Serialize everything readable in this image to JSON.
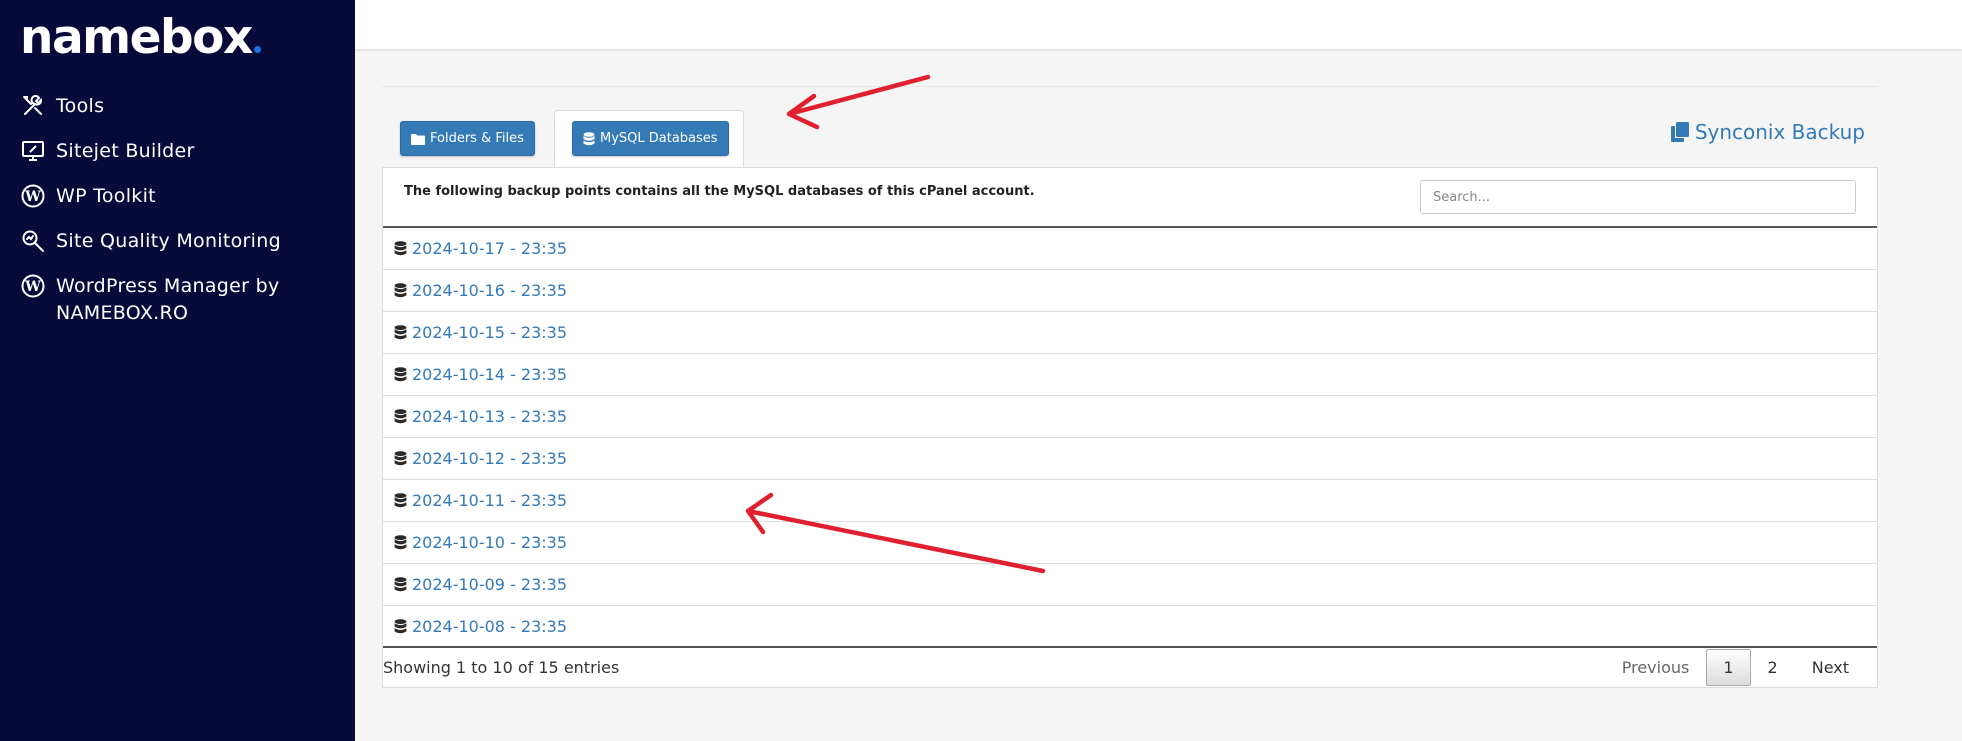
{
  "brand": {
    "logo_text": "namebox",
    "accent": "#1e6fe8"
  },
  "sidebar": {
    "items": [
      {
        "label": "Tools",
        "icon": "tools-icon"
      },
      {
        "label": "Sitejet Builder",
        "icon": "monitor-edit-icon"
      },
      {
        "label": "WP Toolkit",
        "icon": "wordpress-icon"
      },
      {
        "label": "Site Quality Monitoring",
        "icon": "magnify-icon"
      },
      {
        "label": "WordPress Manager by NAMEBOX.RO",
        "icon": "wordpress-icon"
      }
    ]
  },
  "tabs": {
    "folders_label": "Folders & Files",
    "mysql_label": "MySQL Databases"
  },
  "plugin_title": "Synconix Backup",
  "panel": {
    "description": "The following backup points contains all the MySQL databases of this cPanel account.",
    "search_placeholder": "Search..."
  },
  "backups": [
    "2024-10-17 - 23:35",
    "2024-10-16 - 23:35",
    "2024-10-15 - 23:35",
    "2024-10-14 - 23:35",
    "2024-10-13 - 23:35",
    "2024-10-12 - 23:35",
    "2024-10-11 - 23:35",
    "2024-10-10 - 23:35",
    "2024-10-09 - 23:35",
    "2024-10-08 - 23:35"
  ],
  "footer": {
    "info": "Showing 1 to 10 of 15 entries",
    "previous": "Previous",
    "pages": [
      "1",
      "2"
    ],
    "next": "Next"
  },
  "colors": {
    "sidebar_bg": "#080b3a",
    "link": "#337ab7",
    "annotation": "#e0202e"
  }
}
